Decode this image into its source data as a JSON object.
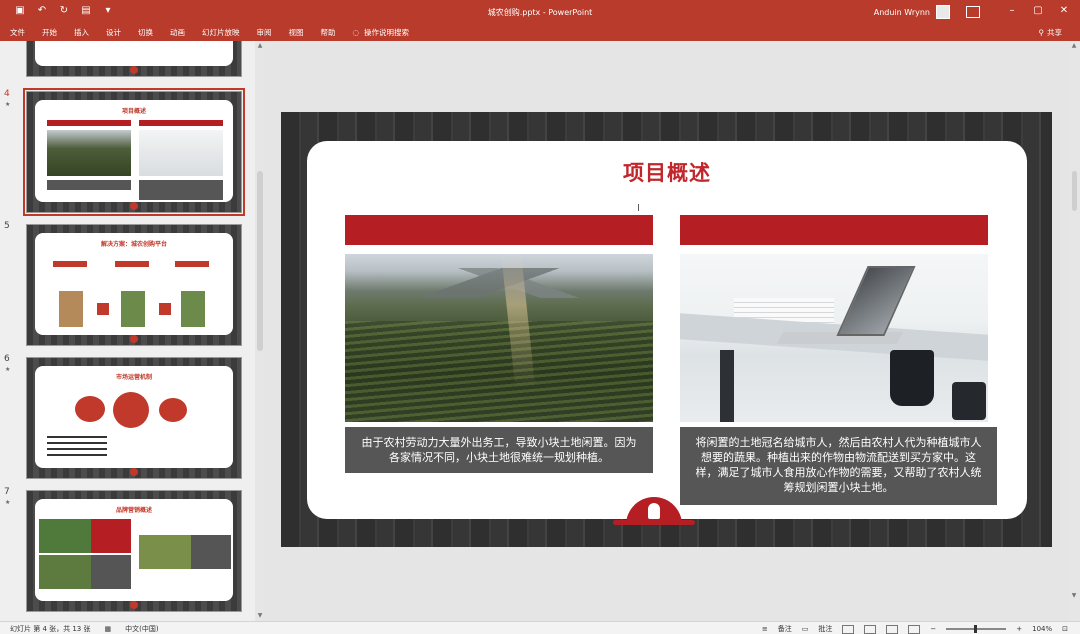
{
  "window": {
    "doc_title": "城农创购.pptx  -  PowerPoint",
    "user_name": "Anduin Wrynn"
  },
  "ribbon_tabs": [
    "文件",
    "开始",
    "插入",
    "设计",
    "切换",
    "动画",
    "幻灯片放映",
    "审阅",
    "视图",
    "帮助"
  ],
  "tell_me": "操作说明搜索",
  "share_label": "共享",
  "thumbnails": [
    {
      "number": "4",
      "title": "项目概述"
    },
    {
      "number": "5",
      "title": "解决方案：城农创购平台"
    },
    {
      "number": "6",
      "title": "市场运营机制"
    },
    {
      "number": "7",
      "title": "品牌营销概述"
    }
  ],
  "slide": {
    "title": "项目概述",
    "left_caption": "由于农村劳动力大量外出务工，导致小块土地闲置。因为各家情况不同，小块土地很难统一规划种植。",
    "right_caption": "将闲置的土地冠名给城市人，然后由农村人代为种植城市人想要的蔬果。种植出来的作物由物流配送到买方家中。这样，满足了城市人食用放心作物的需要，又帮助了农村人统筹规划闲置小块土地。"
  },
  "status": {
    "slide_info": "幻灯片 第 4 张，共 13 张",
    "language": "中文(中国)",
    "notes_label": "备注",
    "comments_label": "批注",
    "zoom": "104%"
  },
  "colors": {
    "accent": "#b83b2b",
    "slide_red": "#b51f24",
    "caption_bg": "#565656"
  }
}
